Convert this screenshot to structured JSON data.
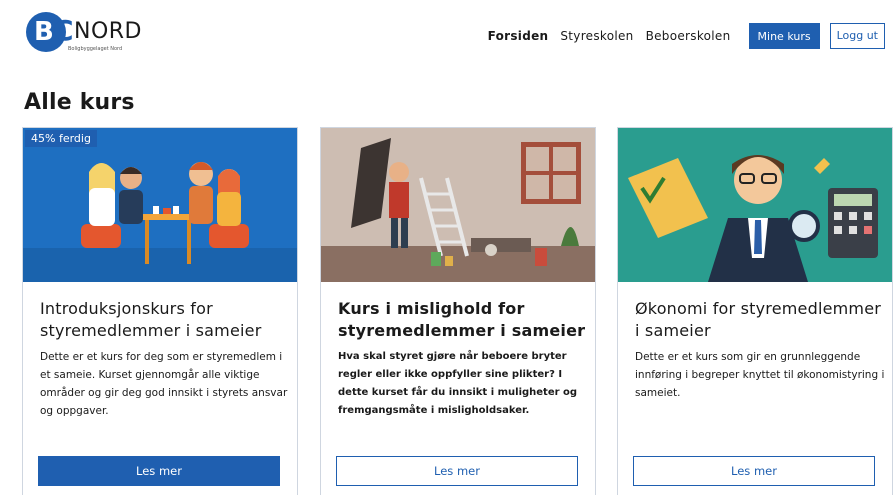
{
  "header": {
    "logo": {
      "mark_letters": "B",
      "mark_second": "C",
      "word": "NORD",
      "tagline": "Boligbyggelaget Nord"
    },
    "nav": [
      {
        "label": "Forsiden",
        "active": true
      },
      {
        "label": "Styreskolen",
        "active": false
      },
      {
        "label": "Beboerskolen",
        "active": false
      }
    ],
    "my_courses_label": "Mine kurs",
    "logout_label": "Logg ut"
  },
  "page_title": "Alle kurs",
  "colors": {
    "brand": "#1f5fb0",
    "text": "#1a1a1a",
    "card_border": "#cfd6e0"
  },
  "cards": [
    {
      "badge": "45% ferdig",
      "progress_percent": 45,
      "illustration": "meeting-illustration",
      "title": "Introduksjonskurs for styremedlemmer i sameier",
      "description": "Dette er et kurs for deg som er styremedlem i et sameie. Kurset gjennomgår alle viktige områder og gir deg god innsikt i styrets ansvar og oppgaver.",
      "button": "Les mer",
      "button_style": "filled"
    },
    {
      "illustration": "messy-room-illustration",
      "title": "Kurs i mislighold for styremedlemmer i sameier",
      "description": "Hva skal styret gjøre når beboere bryter regler eller ikke oppfyller sine plikter? I dette kurset får du innsikt i muligheter og fremgangsmåte i misligholdsaker.",
      "button": "Les mer",
      "button_style": "outline"
    },
    {
      "illustration": "economist-illustration",
      "title": "Økonomi for styremedlemmer i sameier",
      "description": "Dette er et kurs som gir en grunnleggende innføring i begreper knyttet til økonomistyring i sameiet.",
      "button": "Les mer",
      "button_style": "outline"
    }
  ]
}
